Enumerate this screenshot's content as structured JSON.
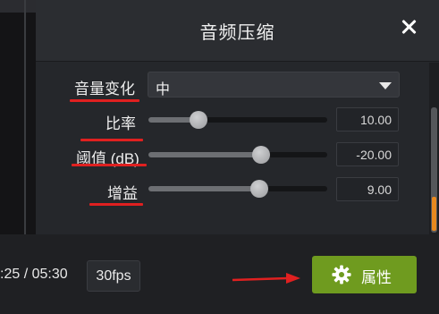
{
  "dialog": {
    "title": "音频压缩",
    "close_icon": "close-icon"
  },
  "fields": {
    "volume_change": {
      "label": "音量变化",
      "selected": "中"
    },
    "ratio": {
      "label": "比率",
      "value": "10.00",
      "level": 0.28
    },
    "threshold": {
      "label": "阈值 (dB)",
      "value": "-20.00",
      "level": 0.63
    },
    "gain": {
      "label": "增益",
      "value": "9.00",
      "level": 0.62
    }
  },
  "bottom": {
    "timecode": ":25 / 05:30",
    "fps": "30fps",
    "properties_button": "属性"
  },
  "colors": {
    "accent_green": "#6f9b1f",
    "annotation_red": "#e02020",
    "scroll_orange": "#e8891f"
  }
}
